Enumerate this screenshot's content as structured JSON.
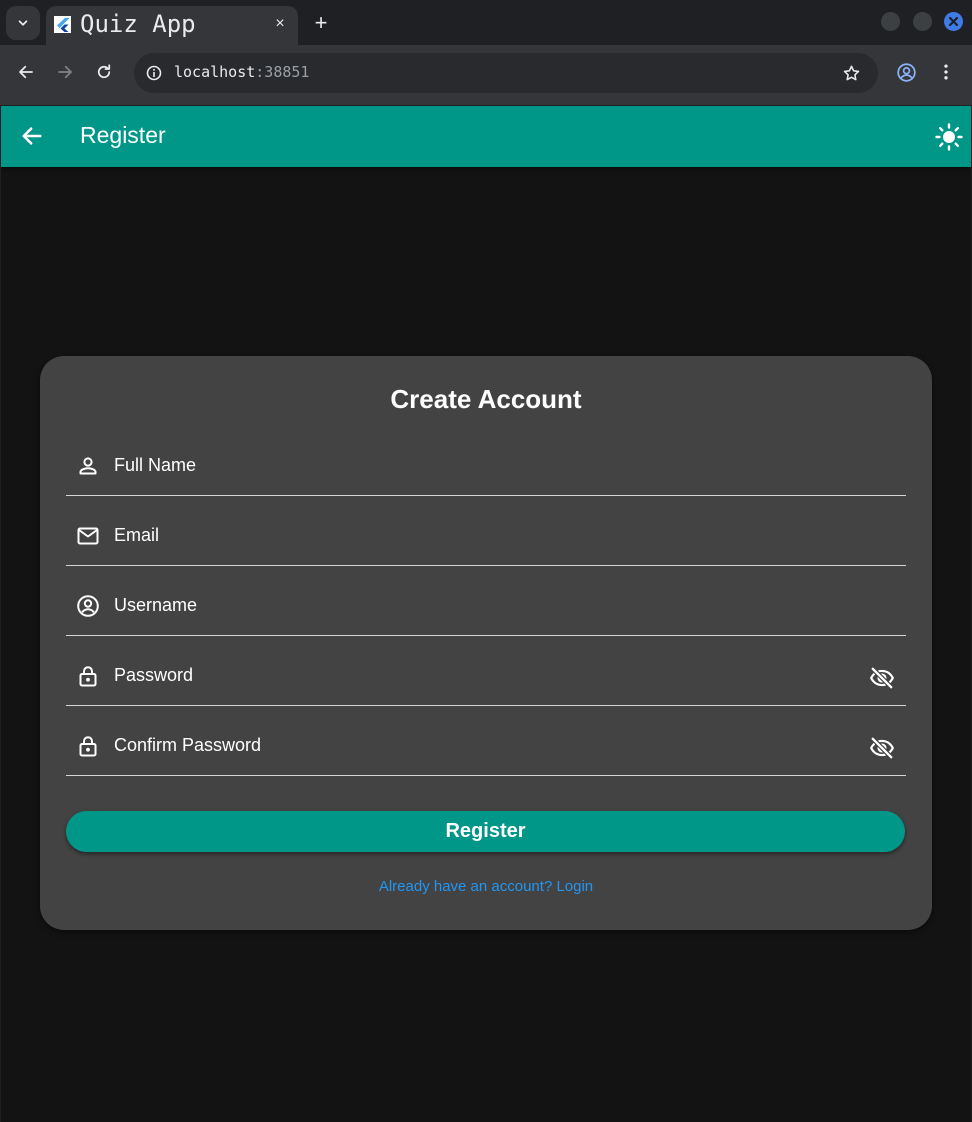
{
  "browser": {
    "tab_title": "Quiz App",
    "tab_close_glyph": "×",
    "new_tab_glyph": "+",
    "url_host": "localhost",
    "url_port": ":38851",
    "icons": [
      "tab-list-icon",
      "flutter-favicon-icon",
      "back-icon",
      "forward-icon",
      "reload-icon",
      "site-info-icon",
      "bookmark-star-icon",
      "profile-icon",
      "menu-icon"
    ]
  },
  "appbar": {
    "title": "Register",
    "color": "#009688",
    "icons": [
      "arrow-back-icon",
      "light-mode-icon"
    ]
  },
  "form": {
    "title": "Create Account",
    "fields": [
      {
        "label": "Full Name",
        "icon": "person-outline-icon"
      },
      {
        "label": "Email",
        "icon": "mail-outline-icon"
      },
      {
        "label": "Username",
        "icon": "account-circle-icon"
      },
      {
        "label": "Password",
        "icon": "lock-icon",
        "suffix_icon": "visibility-off-icon"
      },
      {
        "label": "Confirm Password",
        "icon": "lock-icon",
        "suffix_icon": "visibility-off-icon"
      }
    ],
    "submit_label": "Register",
    "login_link": "Already have an account? Login",
    "link_color": "#2196f3",
    "card_color": "#434343"
  }
}
